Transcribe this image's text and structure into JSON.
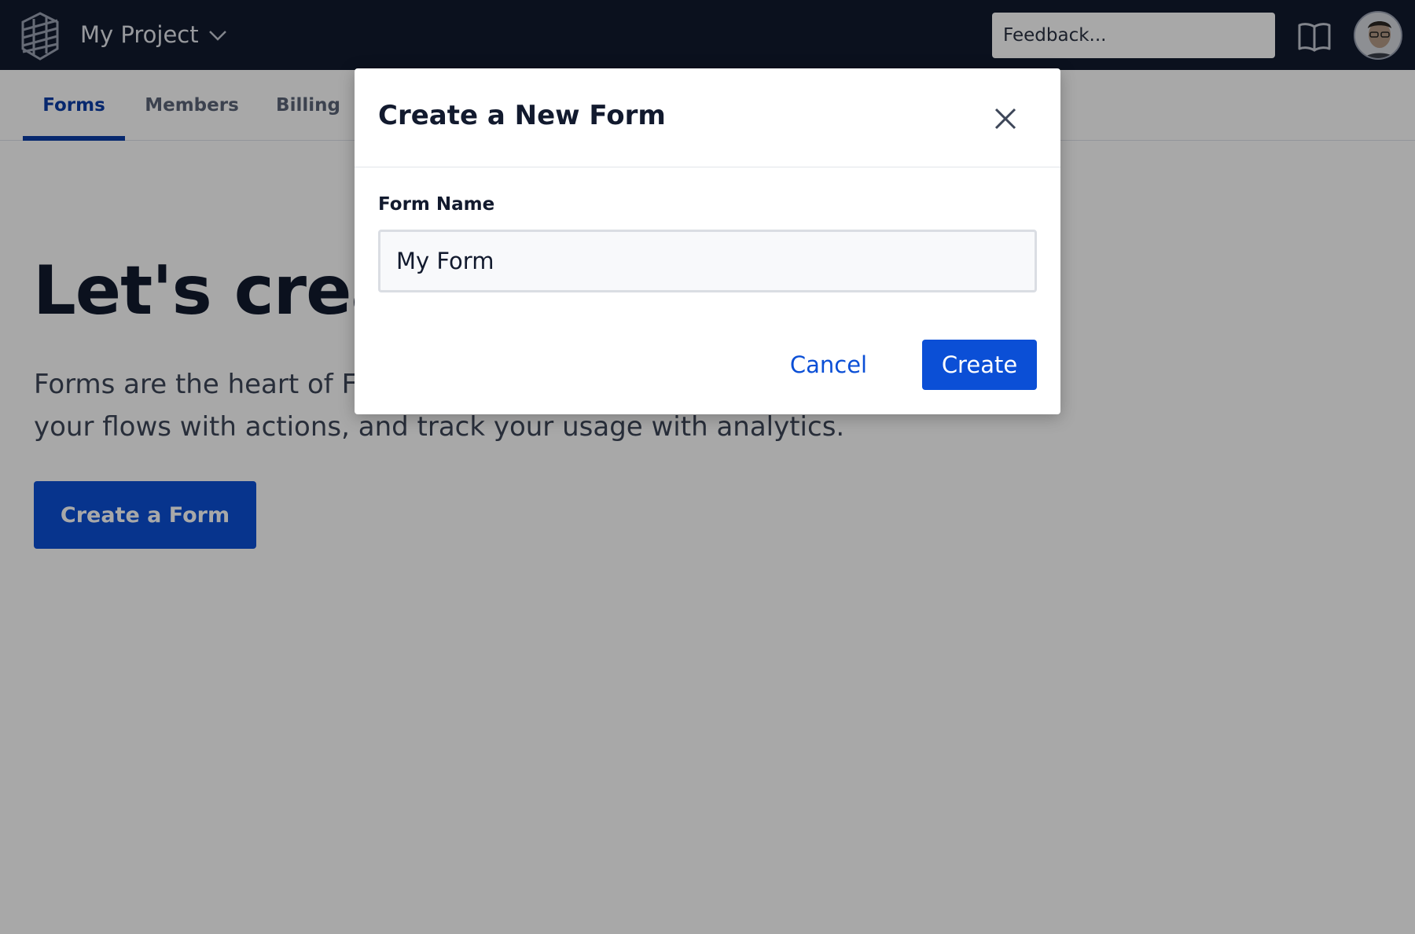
{
  "header": {
    "project_name": "My Project",
    "feedback_placeholder": "Feedback..."
  },
  "tabs": [
    {
      "label": "Forms",
      "active": true
    },
    {
      "label": "Members",
      "active": false
    },
    {
      "label": "Billing",
      "active": false
    }
  ],
  "hero": {
    "title": "Let's create your first form",
    "text_line1": "Forms are the heart of Formspree. Add fields, connect",
    "text_line2": "your flows with actions, and track your usage with analytics.",
    "button_label": "Create a Form"
  },
  "modal": {
    "title": "Create a New Form",
    "field_label": "Form Name",
    "field_value": "My Form",
    "cancel_label": "Cancel",
    "create_label": "Create"
  },
  "colors": {
    "topbar": "#121a2e",
    "accent": "#0b4fd6",
    "tab_active": "#0b3ea8"
  },
  "icons": [
    "logo-icon",
    "chevron-down-icon",
    "book-icon",
    "avatar",
    "close-icon"
  ]
}
